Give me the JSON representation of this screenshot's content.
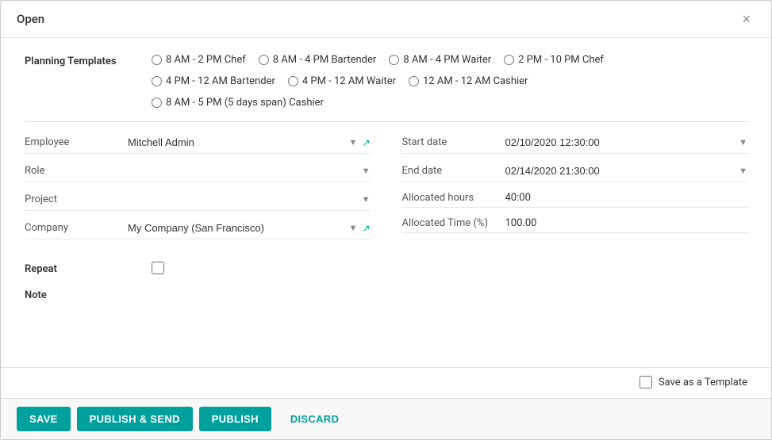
{
  "modal": {
    "title": "Open",
    "close_label": "×"
  },
  "planning_templates": {
    "label": "Planning Templates",
    "options": [
      {
        "id": "t1",
        "label": "8 AM - 2 PM Chef",
        "checked": false
      },
      {
        "id": "t2",
        "label": "8 AM - 4 PM Bartender",
        "checked": false
      },
      {
        "id": "t3",
        "label": "8 AM - 4 PM Waiter",
        "checked": false
      },
      {
        "id": "t4",
        "label": "2 PM - 10 PM Chef",
        "checked": false
      },
      {
        "id": "t5",
        "label": "4 PM - 12 AM Bartender",
        "checked": false
      },
      {
        "id": "t6",
        "label": "4 PM - 12 AM Waiter",
        "checked": false
      },
      {
        "id": "t7",
        "label": "12 AM - 12 AM Cashier",
        "checked": false
      },
      {
        "id": "t8",
        "label": "8 AM - 5 PM (5 days span) Cashier",
        "checked": false
      }
    ]
  },
  "form": {
    "left": {
      "employee": {
        "label": "Employee",
        "value": "Mitchell Admin"
      },
      "role": {
        "label": "Role",
        "value": ""
      },
      "project": {
        "label": "Project",
        "value": ""
      },
      "company": {
        "label": "Company",
        "value": "My Company (San Francisco)"
      }
    },
    "right": {
      "start_date": {
        "label": "Start date",
        "value": "02/10/2020 12:30:00"
      },
      "end_date": {
        "label": "End date",
        "value": "02/14/2020 21:30:00"
      },
      "allocated_hours": {
        "label": "Allocated hours",
        "value": "40:00"
      },
      "allocated_time": {
        "label": "Allocated Time (%)",
        "value": "100.00"
      }
    }
  },
  "repeat": {
    "label": "Repeat"
  },
  "note": {
    "label": "Note"
  },
  "save_template": {
    "label": "Save as a Template"
  },
  "footer": {
    "save": "SAVE",
    "publish_send": "PUBLISH & SEND",
    "publish": "PUBLISH",
    "discard": "DISCARD"
  }
}
